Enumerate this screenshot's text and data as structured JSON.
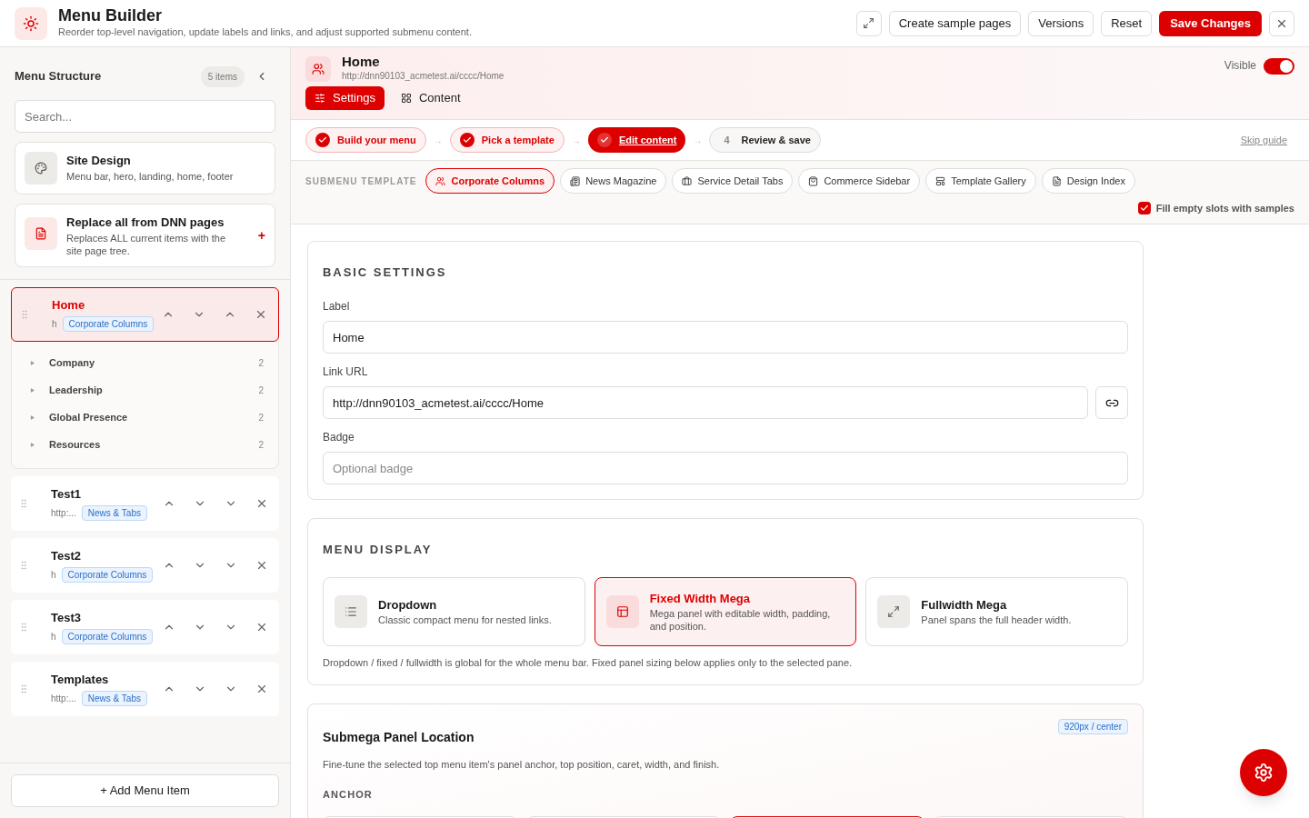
{
  "header": {
    "title": "Menu Builder",
    "subtitle": "Reorder top-level navigation, update labels and links, and adjust supported submenu content.",
    "buttons": [
      {
        "label": "Create sample pages",
        "kind": "default"
      },
      {
        "label": "Versions",
        "kind": "default"
      },
      {
        "label": "Reset",
        "kind": "default"
      },
      {
        "label": "Save Changes",
        "kind": "primary"
      }
    ]
  },
  "sidebar": {
    "title": "Menu Structure",
    "count": "5 items",
    "search_placeholder": "Search...",
    "cards": [
      {
        "title": "Site Design",
        "text": "Menu bar, hero, landing, home, footer",
        "kind": "design"
      },
      {
        "title": "Replace all from DNN pages",
        "text": "Replaces ALL current items with the site page tree.",
        "kind": "replace",
        "action": "+"
      }
    ],
    "items": [
      {
        "label": "Home",
        "url": "h",
        "tag": "Corporate Columns",
        "selected": true,
        "expanded": true,
        "children": [
          {
            "label": "Company",
            "count": "2"
          },
          {
            "label": "Leadership",
            "count": "2"
          },
          {
            "label": "Global Presence",
            "count": "2"
          },
          {
            "label": "Resources",
            "count": "2"
          }
        ]
      },
      {
        "label": "Test1",
        "url": "http:...",
        "tag": "News & Tabs",
        "selected": false,
        "expanded": false
      },
      {
        "label": "Test2",
        "url": "h",
        "tag": "Corporate Columns",
        "selected": false,
        "expanded": false
      },
      {
        "label": "Test3",
        "url": "h",
        "tag": "Corporate Columns",
        "selected": false,
        "expanded": false
      },
      {
        "label": "Templates",
        "url": "http:...",
        "tag": "News & Tabs",
        "selected": false,
        "expanded": false
      }
    ],
    "add_button": "+ Add Menu Item"
  },
  "item_header": {
    "title": "Home",
    "url": "http://dnn90103_acmetest.ai/cccc/Home",
    "visible_label": "Visible",
    "visible": true,
    "tabs": [
      {
        "label": "Settings",
        "selected": true,
        "kind": "settings"
      },
      {
        "label": "Content",
        "selected": false,
        "kind": "content"
      }
    ]
  },
  "steps": [
    {
      "label": "Build your menu",
      "done": true,
      "current": false
    },
    {
      "arrow": "→",
      "label": "Pick a template",
      "done": true,
      "current": false
    },
    {
      "arrow": "→",
      "label": "Edit content",
      "done": true,
      "current": true
    },
    {
      "arrow": "→",
      "label": "Review & save",
      "done": false,
      "current": false,
      "number": "4"
    }
  ],
  "skip_guide": "Skip guide",
  "templates": {
    "label": "SUBMENU TEMPLATE",
    "options": [
      {
        "label": "Corporate Columns",
        "selected": true,
        "kind": "people"
      },
      {
        "label": "News Magazine",
        "selected": false,
        "kind": "news"
      },
      {
        "label": "Service Detail Tabs",
        "selected": false,
        "kind": "briefcase"
      },
      {
        "label": "Commerce Sidebar",
        "selected": false,
        "kind": "bag"
      },
      {
        "label": "Template Gallery",
        "selected": false,
        "kind": "layout"
      },
      {
        "label": "Design Index",
        "selected": false,
        "kind": "doc"
      }
    ],
    "fill_label": "Fill empty slots with samples",
    "fill_checked": true
  },
  "basic": {
    "title": "BASIC SETTINGS",
    "fields": [
      {
        "label": "Label",
        "value": "Home"
      },
      {
        "label": "Link URL",
        "value": "http://dnn90103_acmetest.ai/cccc/Home",
        "kind": "link"
      },
      {
        "label": "Badge",
        "placeholder": "Optional badge"
      }
    ]
  },
  "display": {
    "title": "MENU DISPLAY",
    "options": [
      {
        "title": "Dropdown",
        "text": "Classic compact menu for nested links.",
        "selected": false,
        "kind": "list"
      },
      {
        "title": "Fixed Width Mega",
        "text": "Mega panel with editable width, padding, and position.",
        "selected": true,
        "kind": "panel"
      },
      {
        "title": "Fullwidth Mega",
        "text": "Panel spans the full header width.",
        "selected": false,
        "kind": "expand"
      }
    ],
    "note": "Dropdown / fixed / fullwidth is global for the whole menu bar. Fixed panel sizing below applies only to the selected pane."
  },
  "location": {
    "title": "Submega Panel Location",
    "badge": "920px / center",
    "text": "Fine-tune the selected top menu item's panel anchor, top position, caret, width, and finish.",
    "anchor_label": "ANCHOR",
    "anchors": [
      {
        "selected": false
      },
      {
        "selected": false
      },
      {
        "selected": true
      },
      {
        "selected": false
      }
    ]
  }
}
